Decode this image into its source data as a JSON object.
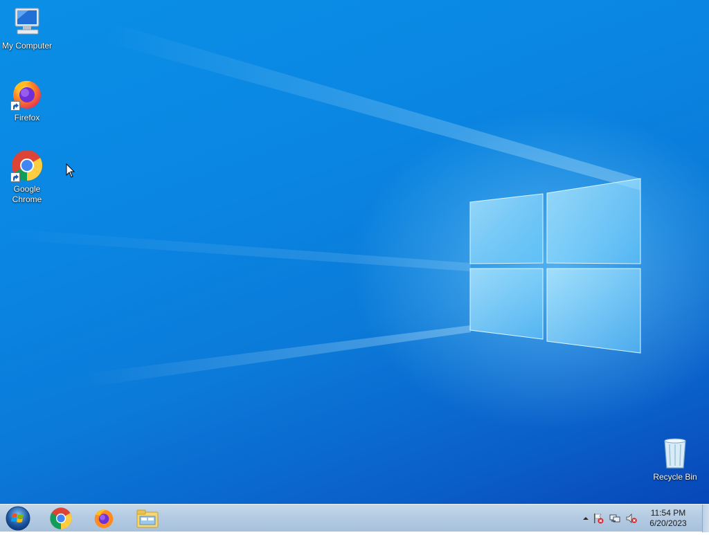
{
  "desktop": {
    "icons": [
      {
        "label": "My Computer",
        "icon": "computer-icon"
      },
      {
        "label": "Firefox",
        "icon": "firefox-icon",
        "shortcut": true
      },
      {
        "label": "Google Chrome",
        "icon": "chrome-icon",
        "shortcut": true
      },
      {
        "label": "Recycle Bin",
        "icon": "recycle-bin-icon"
      }
    ]
  },
  "taskbar": {
    "start": {
      "icon": "windows-start-icon"
    },
    "pinned": [
      {
        "icon": "chrome-icon"
      },
      {
        "icon": "firefox-icon"
      },
      {
        "icon": "file-explorer-icon"
      }
    ],
    "tray": {
      "icons": [
        "show-hidden-icons-chevron-icon",
        "action-center-flag-icon",
        "network-icon",
        "volume-muted-icon"
      ],
      "clock": {
        "time": "11:54 PM",
        "date": "6/20/2023"
      }
    }
  },
  "colors": {
    "wallpaper_primary": "#0a86e2",
    "wallpaper_dark": "#0846b8",
    "taskbar": "#b4cbe2"
  }
}
